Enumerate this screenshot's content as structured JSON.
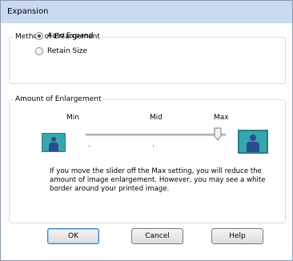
{
  "dialog": {
    "title": "Expansion"
  },
  "method_group": {
    "legend": "Method of Enlargement",
    "options": [
      {
        "label": "Auto Expand",
        "checked": true
      },
      {
        "label": "Retain Size",
        "checked": false
      }
    ]
  },
  "amount_group": {
    "legend": "Amount of Enlargement",
    "slider": {
      "labels": [
        "Min",
        "Mid",
        "Max"
      ],
      "selected": "Max"
    },
    "info_text": "If you move the slider off the Max setting, you will reduce the amount of image enlargement. However, you may see a white border around your printed image."
  },
  "buttons": {
    "ok": "OK",
    "cancel": "Cancel",
    "help": "Help"
  },
  "colors": {
    "titlebar": "#c9daf0",
    "icon_fill": "#36a6b0",
    "person": "#2a4d8f"
  }
}
